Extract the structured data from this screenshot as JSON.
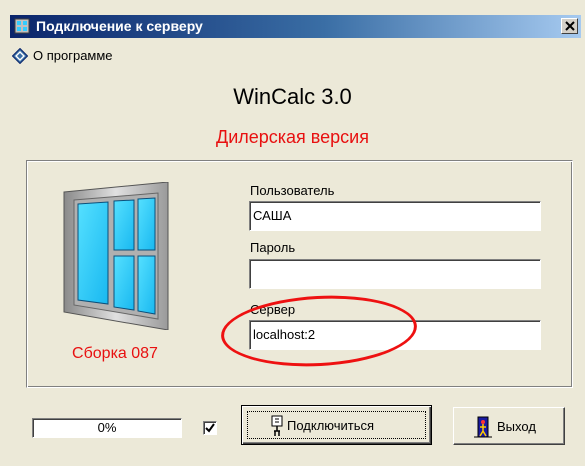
{
  "window": {
    "title": "Подключение к серверу",
    "close_glyph": "x"
  },
  "menu": {
    "about_label": "О программе",
    "about_icon": "info-diamond-icon"
  },
  "app": {
    "name": "WinCalc 3.0",
    "edition": "Дилерская версия",
    "build": "Сборка 087"
  },
  "form": {
    "user_label": "Пользователь",
    "user_value": "САША",
    "password_label": "Пароль",
    "password_value": "",
    "server_label": "Сервер",
    "server_value": "localhost:2"
  },
  "status": {
    "progress_text": "0%",
    "progress_percent": 0,
    "checkbox_checked": true
  },
  "buttons": {
    "connect_label": "Подключиться",
    "exit_label": "Выход"
  },
  "colors": {
    "accent_red": "#e81010",
    "titlebar_dark": "#0a246a",
    "window_face": "#ece9d8"
  }
}
